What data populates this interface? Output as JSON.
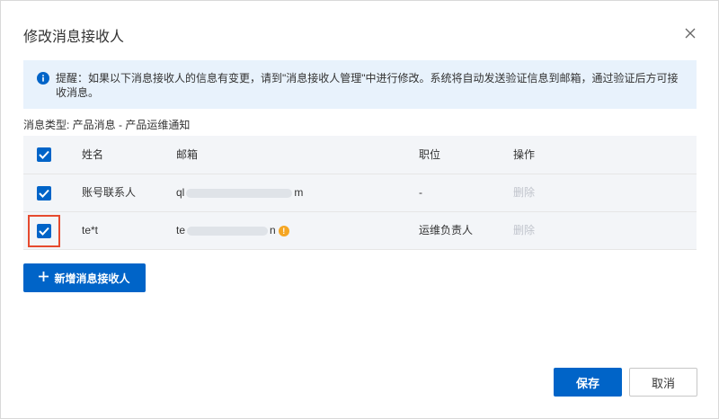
{
  "dialog": {
    "title": "修改消息接收人",
    "close_icon": "close-icon"
  },
  "notice": {
    "icon": "info-icon",
    "text": "提醒：如果以下消息接收人的信息有变更，请到\"消息接收人管理\"中进行修改。系统将自动发送验证信息到邮箱，通过验证后方可接收消息。"
  },
  "message_type": "消息类型: 产品消息 - 产品运维通知",
  "table": {
    "columns": [
      "姓名",
      "邮箱",
      "职位",
      "操作"
    ],
    "header_checked": true,
    "rows": [
      {
        "checked": true,
        "name": "账号联系人",
        "email_prefix": "ql",
        "email_suffix": "m",
        "role": "-",
        "action": "删除",
        "warning": false
      },
      {
        "checked": true,
        "name": "te*t",
        "email_prefix": "te",
        "email_suffix": "n",
        "role": "运维负责人",
        "action": "删除",
        "warning": true
      }
    ]
  },
  "buttons": {
    "add_receiver": "新增消息接收人",
    "save": "保存",
    "cancel": "取消"
  },
  "colors": {
    "primary": "#0064c8",
    "notice_bg": "#e8f2fc",
    "highlight": "#e64a2e",
    "warning": "#f5a623"
  }
}
